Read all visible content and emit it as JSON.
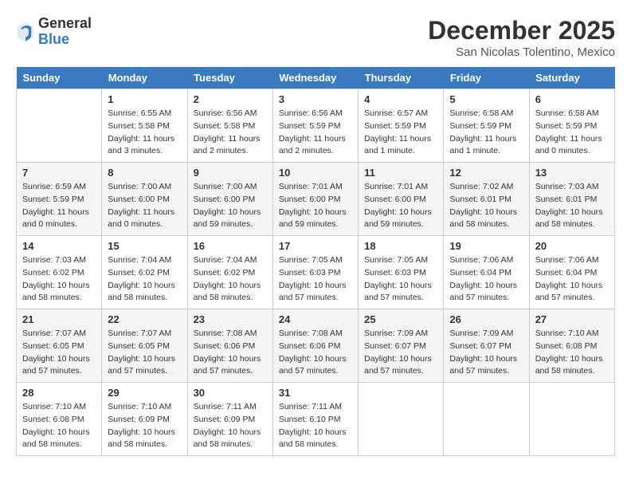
{
  "header": {
    "logo_general": "General",
    "logo_blue": "Blue",
    "month": "December 2025",
    "location": "San Nicolas Tolentino, Mexico"
  },
  "days_of_week": [
    "Sunday",
    "Monday",
    "Tuesday",
    "Wednesday",
    "Thursday",
    "Friday",
    "Saturday"
  ],
  "weeks": [
    [
      {
        "day": "",
        "empty": true
      },
      {
        "day": "1",
        "sunrise": "Sunrise: 6:55 AM",
        "sunset": "Sunset: 5:58 PM",
        "daylight": "Daylight: 11 hours and 3 minutes."
      },
      {
        "day": "2",
        "sunrise": "Sunrise: 6:56 AM",
        "sunset": "Sunset: 5:58 PM",
        "daylight": "Daylight: 11 hours and 2 minutes."
      },
      {
        "day": "3",
        "sunrise": "Sunrise: 6:56 AM",
        "sunset": "Sunset: 5:59 PM",
        "daylight": "Daylight: 11 hours and 2 minutes."
      },
      {
        "day": "4",
        "sunrise": "Sunrise: 6:57 AM",
        "sunset": "Sunset: 5:59 PM",
        "daylight": "Daylight: 11 hours and 1 minute."
      },
      {
        "day": "5",
        "sunrise": "Sunrise: 6:58 AM",
        "sunset": "Sunset: 5:59 PM",
        "daylight": "Daylight: 11 hours and 1 minute."
      },
      {
        "day": "6",
        "sunrise": "Sunrise: 6:58 AM",
        "sunset": "Sunset: 5:59 PM",
        "daylight": "Daylight: 11 hours and 0 minutes."
      }
    ],
    [
      {
        "day": "7",
        "sunrise": "Sunrise: 6:59 AM",
        "sunset": "Sunset: 5:59 PM",
        "daylight": "Daylight: 11 hours and 0 minutes."
      },
      {
        "day": "8",
        "sunrise": "Sunrise: 7:00 AM",
        "sunset": "Sunset: 6:00 PM",
        "daylight": "Daylight: 11 hours and 0 minutes."
      },
      {
        "day": "9",
        "sunrise": "Sunrise: 7:00 AM",
        "sunset": "Sunset: 6:00 PM",
        "daylight": "Daylight: 10 hours and 59 minutes."
      },
      {
        "day": "10",
        "sunrise": "Sunrise: 7:01 AM",
        "sunset": "Sunset: 6:00 PM",
        "daylight": "Daylight: 10 hours and 59 minutes."
      },
      {
        "day": "11",
        "sunrise": "Sunrise: 7:01 AM",
        "sunset": "Sunset: 6:00 PM",
        "daylight": "Daylight: 10 hours and 59 minutes."
      },
      {
        "day": "12",
        "sunrise": "Sunrise: 7:02 AM",
        "sunset": "Sunset: 6:01 PM",
        "daylight": "Daylight: 10 hours and 58 minutes."
      },
      {
        "day": "13",
        "sunrise": "Sunrise: 7:03 AM",
        "sunset": "Sunset: 6:01 PM",
        "daylight": "Daylight: 10 hours and 58 minutes."
      }
    ],
    [
      {
        "day": "14",
        "sunrise": "Sunrise: 7:03 AM",
        "sunset": "Sunset: 6:02 PM",
        "daylight": "Daylight: 10 hours and 58 minutes."
      },
      {
        "day": "15",
        "sunrise": "Sunrise: 7:04 AM",
        "sunset": "Sunset: 6:02 PM",
        "daylight": "Daylight: 10 hours and 58 minutes."
      },
      {
        "day": "16",
        "sunrise": "Sunrise: 7:04 AM",
        "sunset": "Sunset: 6:02 PM",
        "daylight": "Daylight: 10 hours and 58 minutes."
      },
      {
        "day": "17",
        "sunrise": "Sunrise: 7:05 AM",
        "sunset": "Sunset: 6:03 PM",
        "daylight": "Daylight: 10 hours and 57 minutes."
      },
      {
        "day": "18",
        "sunrise": "Sunrise: 7:05 AM",
        "sunset": "Sunset: 6:03 PM",
        "daylight": "Daylight: 10 hours and 57 minutes."
      },
      {
        "day": "19",
        "sunrise": "Sunrise: 7:06 AM",
        "sunset": "Sunset: 6:04 PM",
        "daylight": "Daylight: 10 hours and 57 minutes."
      },
      {
        "day": "20",
        "sunrise": "Sunrise: 7:06 AM",
        "sunset": "Sunset: 6:04 PM",
        "daylight": "Daylight: 10 hours and 57 minutes."
      }
    ],
    [
      {
        "day": "21",
        "sunrise": "Sunrise: 7:07 AM",
        "sunset": "Sunset: 6:05 PM",
        "daylight": "Daylight: 10 hours and 57 minutes."
      },
      {
        "day": "22",
        "sunrise": "Sunrise: 7:07 AM",
        "sunset": "Sunset: 6:05 PM",
        "daylight": "Daylight: 10 hours and 57 minutes."
      },
      {
        "day": "23",
        "sunrise": "Sunrise: 7:08 AM",
        "sunset": "Sunset: 6:06 PM",
        "daylight": "Daylight: 10 hours and 57 minutes."
      },
      {
        "day": "24",
        "sunrise": "Sunrise: 7:08 AM",
        "sunset": "Sunset: 6:06 PM",
        "daylight": "Daylight: 10 hours and 57 minutes."
      },
      {
        "day": "25",
        "sunrise": "Sunrise: 7:09 AM",
        "sunset": "Sunset: 6:07 PM",
        "daylight": "Daylight: 10 hours and 57 minutes."
      },
      {
        "day": "26",
        "sunrise": "Sunrise: 7:09 AM",
        "sunset": "Sunset: 6:07 PM",
        "daylight": "Daylight: 10 hours and 57 minutes."
      },
      {
        "day": "27",
        "sunrise": "Sunrise: 7:10 AM",
        "sunset": "Sunset: 6:08 PM",
        "daylight": "Daylight: 10 hours and 58 minutes."
      }
    ],
    [
      {
        "day": "28",
        "sunrise": "Sunrise: 7:10 AM",
        "sunset": "Sunset: 6:08 PM",
        "daylight": "Daylight: 10 hours and 58 minutes."
      },
      {
        "day": "29",
        "sunrise": "Sunrise: 7:10 AM",
        "sunset": "Sunset: 6:09 PM",
        "daylight": "Daylight: 10 hours and 58 minutes."
      },
      {
        "day": "30",
        "sunrise": "Sunrise: 7:11 AM",
        "sunset": "Sunset: 6:09 PM",
        "daylight": "Daylight: 10 hours and 58 minutes."
      },
      {
        "day": "31",
        "sunrise": "Sunrise: 7:11 AM",
        "sunset": "Sunset: 6:10 PM",
        "daylight": "Daylight: 10 hours and 58 minutes."
      },
      {
        "day": "",
        "empty": true
      },
      {
        "day": "",
        "empty": true
      },
      {
        "day": "",
        "empty": true
      }
    ]
  ]
}
